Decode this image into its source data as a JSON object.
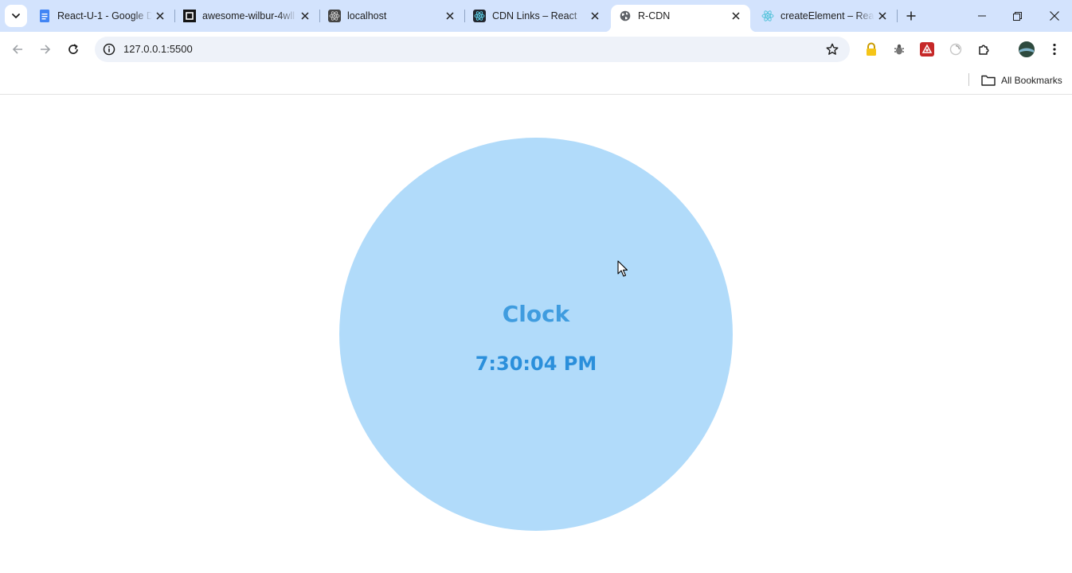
{
  "browser": {
    "tabs": [
      {
        "title": "React-U-1 - Google D",
        "favicon": "google-docs-icon",
        "active": false
      },
      {
        "title": "awesome-wilbur-4wll",
        "favicon": "codesandbox-icon",
        "active": false
      },
      {
        "title": "localhost",
        "favicon": "react-icon",
        "active": false
      },
      {
        "title": "CDN Links – React",
        "favicon": "react-icon",
        "active": false
      },
      {
        "title": "R-CDN",
        "favicon": "globe-icon",
        "active": true
      },
      {
        "title": "createElement – Reac",
        "favicon": "react-icon",
        "active": false
      }
    ],
    "address_bar": {
      "url": "127.0.0.1:5500"
    },
    "bookmarks_bar": {
      "all_bookmarks_label": "All Bookmarks"
    },
    "colors": {
      "tabstrip": "#d3e3fd",
      "omnibox": "#eef2f9"
    }
  },
  "page": {
    "clock": {
      "title": "Clock",
      "time": "7:30:04 PM",
      "colors": {
        "circle": "#b1dbfa",
        "title": "#3f9cdf",
        "time": "#2b8fdb"
      }
    }
  }
}
